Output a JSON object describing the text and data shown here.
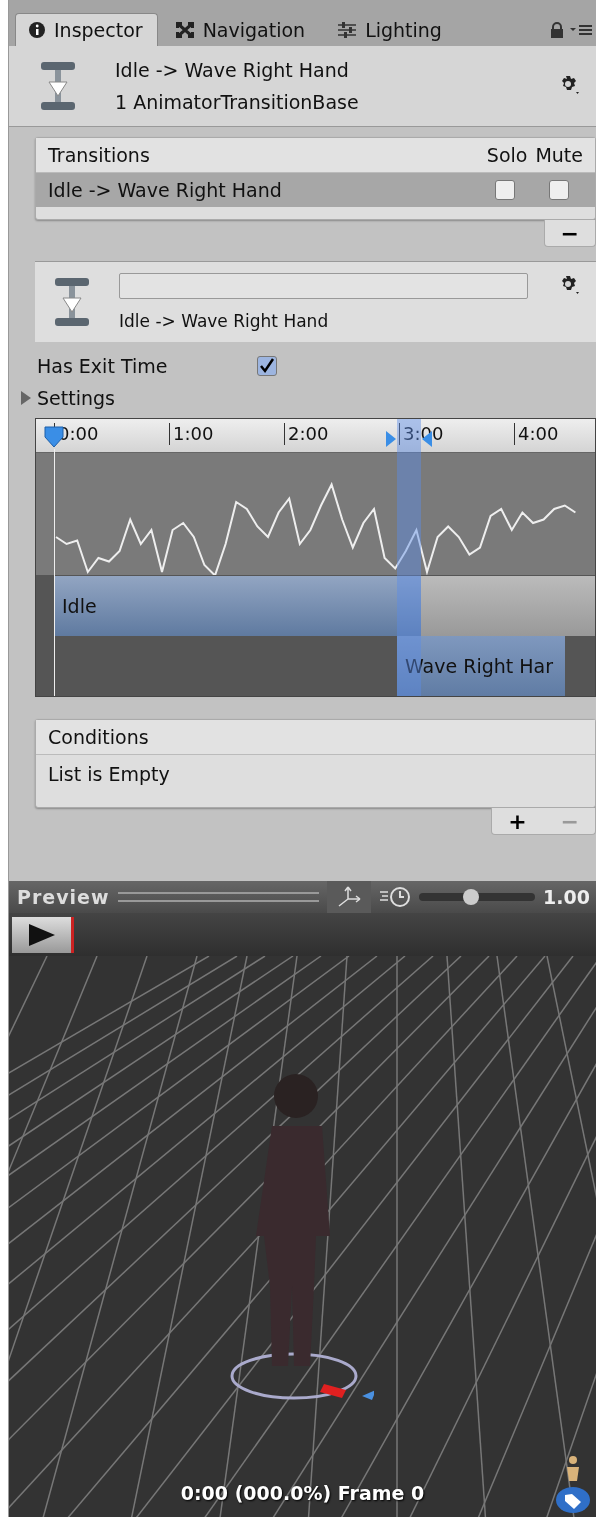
{
  "tabs": [
    {
      "label": "Inspector",
      "selected": true
    },
    {
      "label": "Navigation",
      "selected": false
    },
    {
      "label": "Lighting",
      "selected": false
    }
  ],
  "header": {
    "title": "Idle -> Wave Right Hand",
    "subtitle": "1 AnimatorTransitionBase"
  },
  "transitions": {
    "title": "Transitions",
    "columns": [
      "Solo",
      "Mute"
    ],
    "rows": [
      {
        "name": "Idle -> Wave Right Hand",
        "selected": true,
        "solo": false,
        "mute": false
      }
    ],
    "remove_button": "−"
  },
  "transition": {
    "label": "Idle -> Wave Right Hand"
  },
  "has_exit_time": {
    "label": "Has Exit Time",
    "checked": true
  },
  "settings": {
    "label": "Settings",
    "expanded": false
  },
  "timeline": {
    "ticks": [
      "0:00",
      "1:00",
      "2:00",
      "3:00",
      "4:00"
    ],
    "tracks": [
      {
        "label": "Idle"
      },
      {
        "label": "Wave Right Har"
      }
    ]
  },
  "conditions": {
    "title": "Conditions",
    "empty_text": "List is Empty",
    "add_button": "+",
    "remove_button": "−"
  },
  "preview": {
    "title": "Preview",
    "speed": {
      "level": 0.45,
      "reading": "1.00"
    },
    "status": "0:00 (000.0%) Frame 0"
  }
}
